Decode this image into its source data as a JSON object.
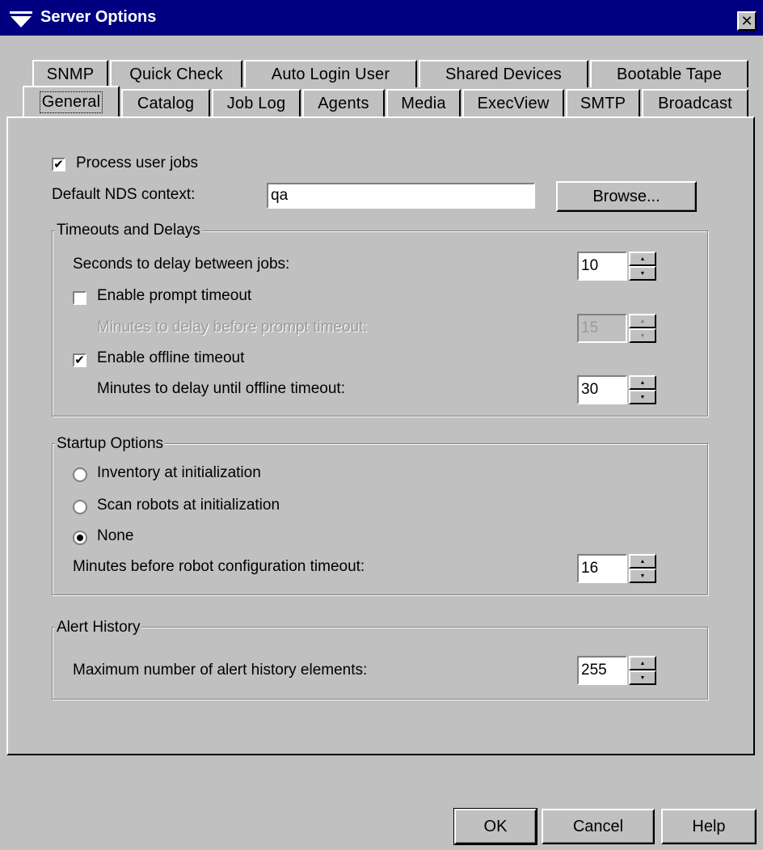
{
  "window": {
    "title": "Server Options",
    "close_glyph": "✕"
  },
  "tabs_row1": [
    "SNMP",
    "Quick Check",
    "Auto Login User",
    "Shared Devices",
    "Bootable Tape"
  ],
  "tabs_row2": [
    "General",
    "Catalog",
    "Job Log",
    "Agents",
    "Media",
    "ExecView",
    "SMTP",
    "Broadcast"
  ],
  "active_tab": "General",
  "general": {
    "process_user_jobs": {
      "label": "Process user jobs",
      "checked": true
    },
    "nds_context": {
      "label": "Default NDS context:",
      "value": "qa"
    },
    "browse_label": "Browse..."
  },
  "timeouts": {
    "title": "Timeouts and Delays",
    "delay_between_jobs": {
      "label": "Seconds to delay between jobs:",
      "value": "10"
    },
    "enable_prompt_timeout": {
      "label": "Enable prompt timeout",
      "checked": false
    },
    "prompt_timeout_minutes": {
      "label": "Minutes to delay before prompt timeout:",
      "value": "15",
      "enabled": false
    },
    "enable_offline_timeout": {
      "label": "Enable offline timeout",
      "checked": true
    },
    "offline_timeout_minutes": {
      "label": "Minutes to delay until offline timeout:",
      "value": "30"
    }
  },
  "startup": {
    "title": "Startup Options",
    "options": [
      "Inventory at initialization",
      "Scan robots at initialization",
      "None"
    ],
    "selected": "None",
    "robot_timeout": {
      "label": "Minutes before robot configuration timeout:",
      "value": "16"
    }
  },
  "alert_history": {
    "title": "Alert History",
    "max_elements": {
      "label": "Maximum number of alert history elements:",
      "value": "255"
    }
  },
  "buttons": {
    "ok": "OK",
    "cancel": "Cancel",
    "help": "Help"
  }
}
